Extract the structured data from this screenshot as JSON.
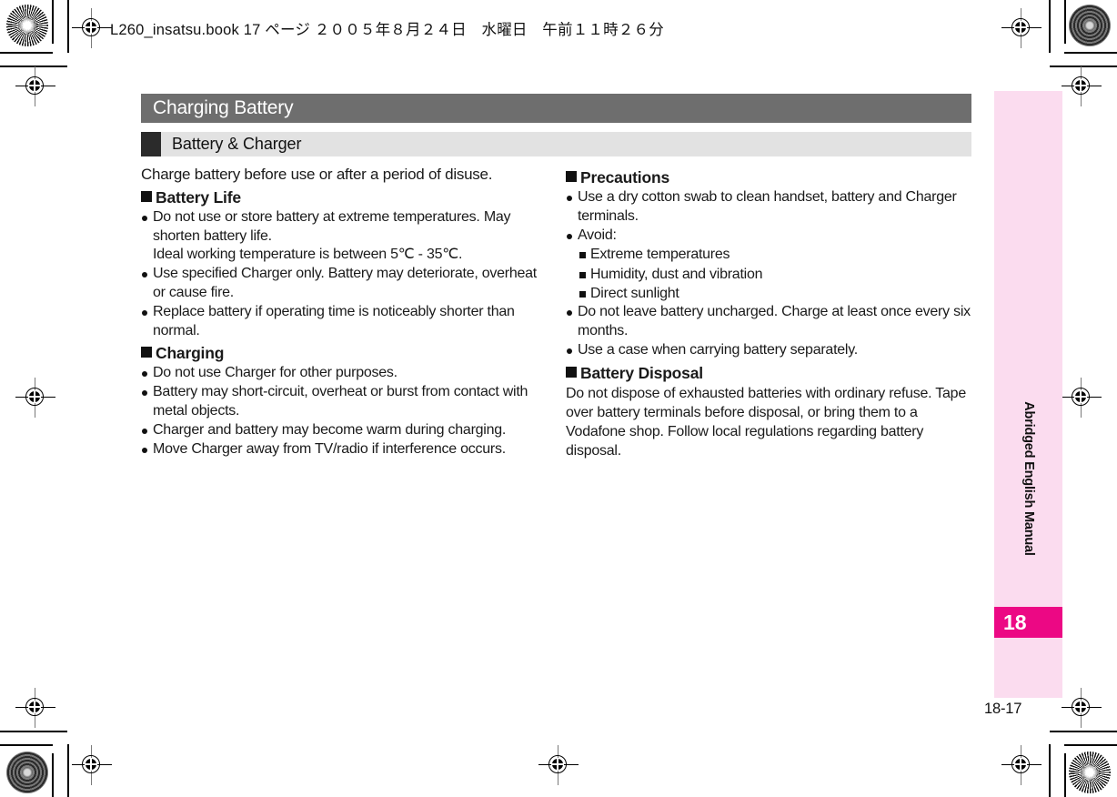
{
  "file_header": "L260_insatsu.book  17 ページ  ２００５年８月２４日　水曜日　午前１１時２６分",
  "chapter": {
    "title": "Charging Battery"
  },
  "section": {
    "title": "Battery & Charger"
  },
  "left_column": {
    "lead": "Charge battery before use or after a period of disuse.",
    "headings": [
      {
        "title": "Battery Life"
      },
      {
        "title": "Charging"
      }
    ],
    "battery_life_items": [
      "Do not use or store battery at extreme temperatures. May shorten battery life.",
      "Use specified Charger only. Battery may deteriorate, overheat or cause fire.",
      "Replace battery if operating time is noticeably shorter than normal."
    ],
    "battery_life_continuation": "Ideal working temperature is between 5℃ - 35℃.",
    "charging_items": [
      "Do not use Charger for other purposes.",
      "Battery may short-circuit, overheat or burst from contact with metal objects.",
      "Charger and battery may become warm during charging.",
      "Move Charger away from TV/radio if interference occurs."
    ]
  },
  "right_column": {
    "headings": [
      {
        "title": "Precautions"
      },
      {
        "title": "Battery Disposal"
      }
    ],
    "precautions_items_a": [
      "Use a dry cotton swab to clean handset, battery and Charger terminals.",
      "Avoid:"
    ],
    "avoid_subitems": [
      "Extreme temperatures",
      "Humidity, dust and vibration",
      "Direct sunlight"
    ],
    "precautions_items_b": [
      "Do not leave battery uncharged. Charge at least once every six months.",
      "Use a case when carrying battery separately."
    ],
    "disposal_paragraph": "Do not dispose of exhausted batteries with ordinary refuse. Tape over battery terminals before disposal, or bring them to a Vodafone shop. Follow local regulations regarding battery disposal."
  },
  "sidebar": {
    "vertical_label": "Abridged English Manual",
    "chapter_number": "18"
  },
  "folio": "18-17",
  "colors": {
    "chapter_bar": "#6e6e6e",
    "section_bar": "#e2e2e2",
    "section_marker": "#2b2b2b",
    "sidebar_pink": "#fbdcef",
    "sidebar_chip_magenta": "#ec0884",
    "text": "#1a1a1a"
  }
}
